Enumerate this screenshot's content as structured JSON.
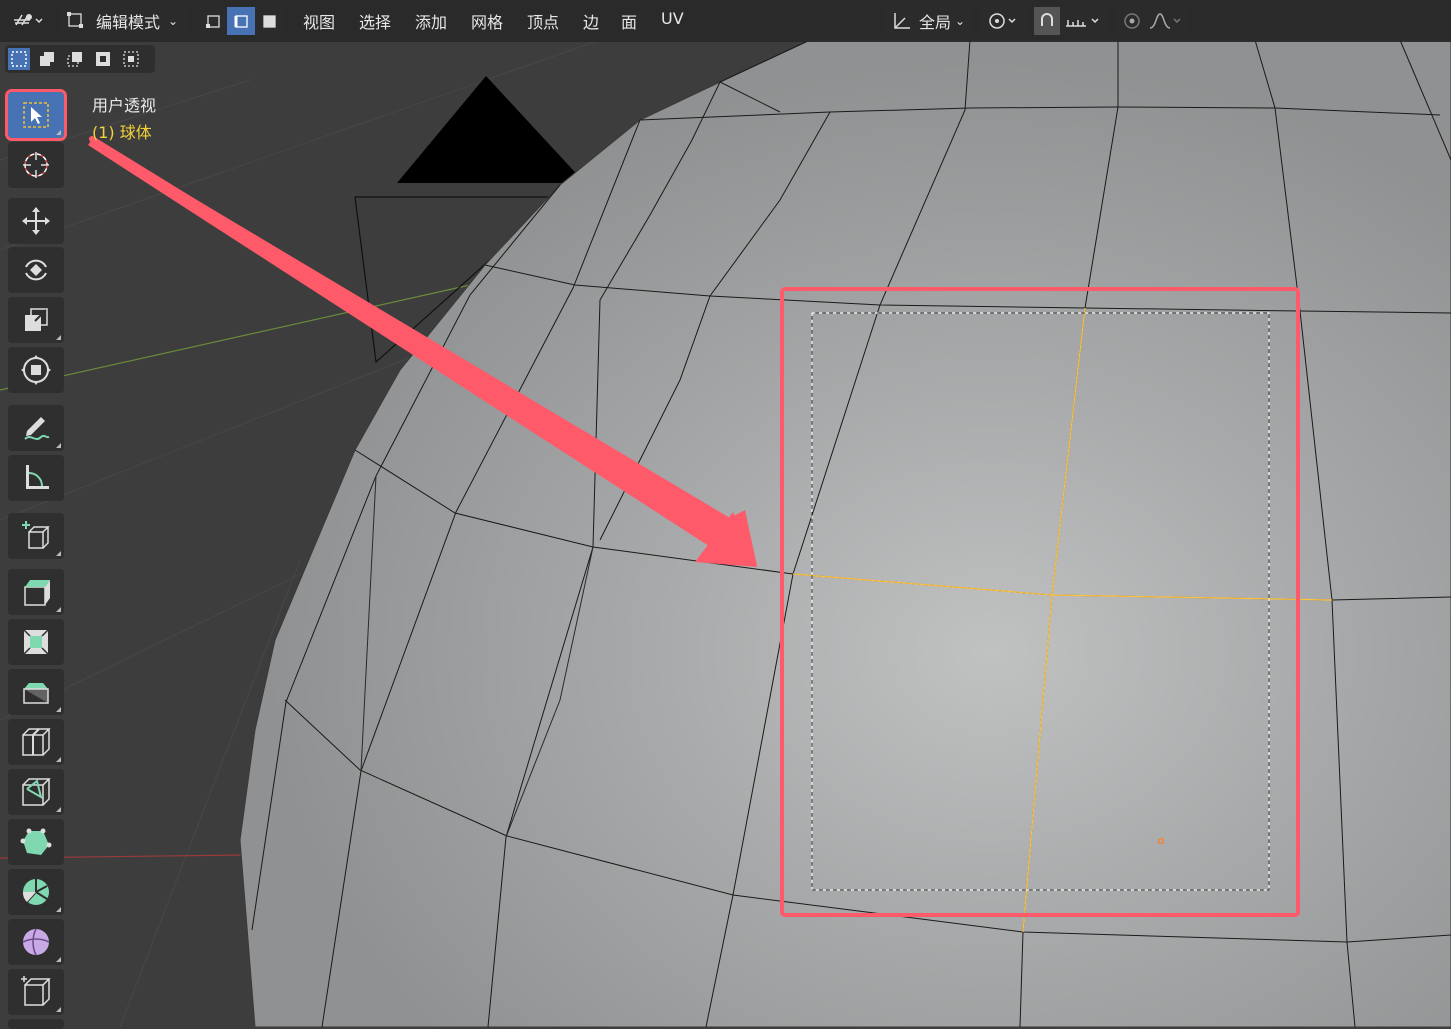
{
  "header": {
    "mode_label": "编辑模式",
    "menus": [
      "视图",
      "选择",
      "添加",
      "网格",
      "顶点",
      "边",
      "面",
      "UV"
    ],
    "transform_orientation": "全局"
  },
  "viewport": {
    "view_name": "用户透视",
    "object_label": "(1) 球体",
    "selection_color": "#ffc23a",
    "annotation_color": "#ff5a6a",
    "mesh_color": "#9fa1a3"
  },
  "toolbar": {
    "tools": [
      {
        "name": "select-box",
        "active": true
      },
      {
        "name": "cursor"
      },
      {
        "name": "move"
      },
      {
        "name": "rotate"
      },
      {
        "name": "scale"
      },
      {
        "name": "transform"
      },
      {
        "name": "annotate"
      },
      {
        "name": "measure"
      },
      {
        "name": "add-cube"
      },
      {
        "name": "extrude-region"
      },
      {
        "name": "inset-faces"
      },
      {
        "name": "bevel"
      },
      {
        "name": "loop-cut"
      },
      {
        "name": "knife"
      },
      {
        "name": "poly-build"
      },
      {
        "name": "spin"
      },
      {
        "name": "smooth"
      },
      {
        "name": "edge-slide"
      }
    ]
  }
}
